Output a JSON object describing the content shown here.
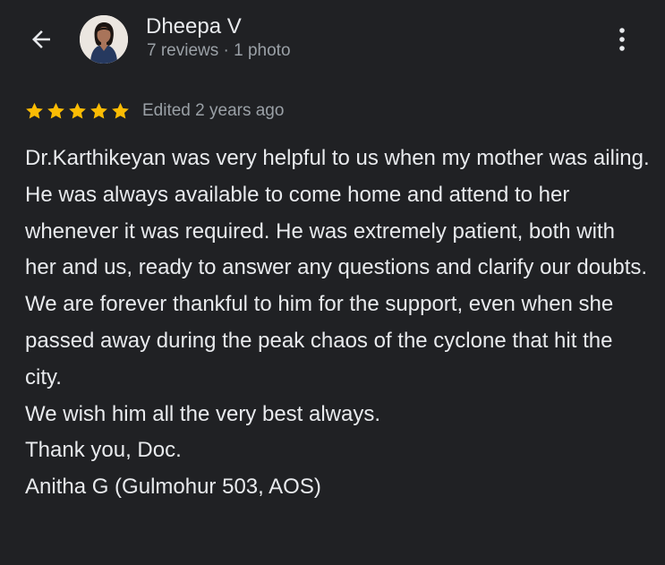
{
  "reviewer": {
    "name": "Dheepa V",
    "meta": "7 reviews · 1 photo"
  },
  "rating": {
    "stars": 5,
    "max": 5,
    "star_color": "#fbbc04",
    "edited": "Edited 2 years ago"
  },
  "review": {
    "paragraphs": [
      "Dr.Karthikeyan was very helpful to us when my mother was ailing. He was always available to come home and attend to her whenever it was required. He was extremely patient, both with her and us, ready to answer any questions and clarify our doubts. We are forever thankful to him for the support, even when she passed away during the peak chaos of the cyclone that hit the city.",
      "We wish him all the very best always.",
      "Thank you, Doc.",
      "Anitha G (Gulmohur 503, AOS)"
    ]
  },
  "icons": {
    "back": "arrow-back-icon",
    "more": "more-vert-icon"
  },
  "colors": {
    "background": "#202124",
    "text": "#e8eaed",
    "secondary_text": "#9aa0a6"
  }
}
